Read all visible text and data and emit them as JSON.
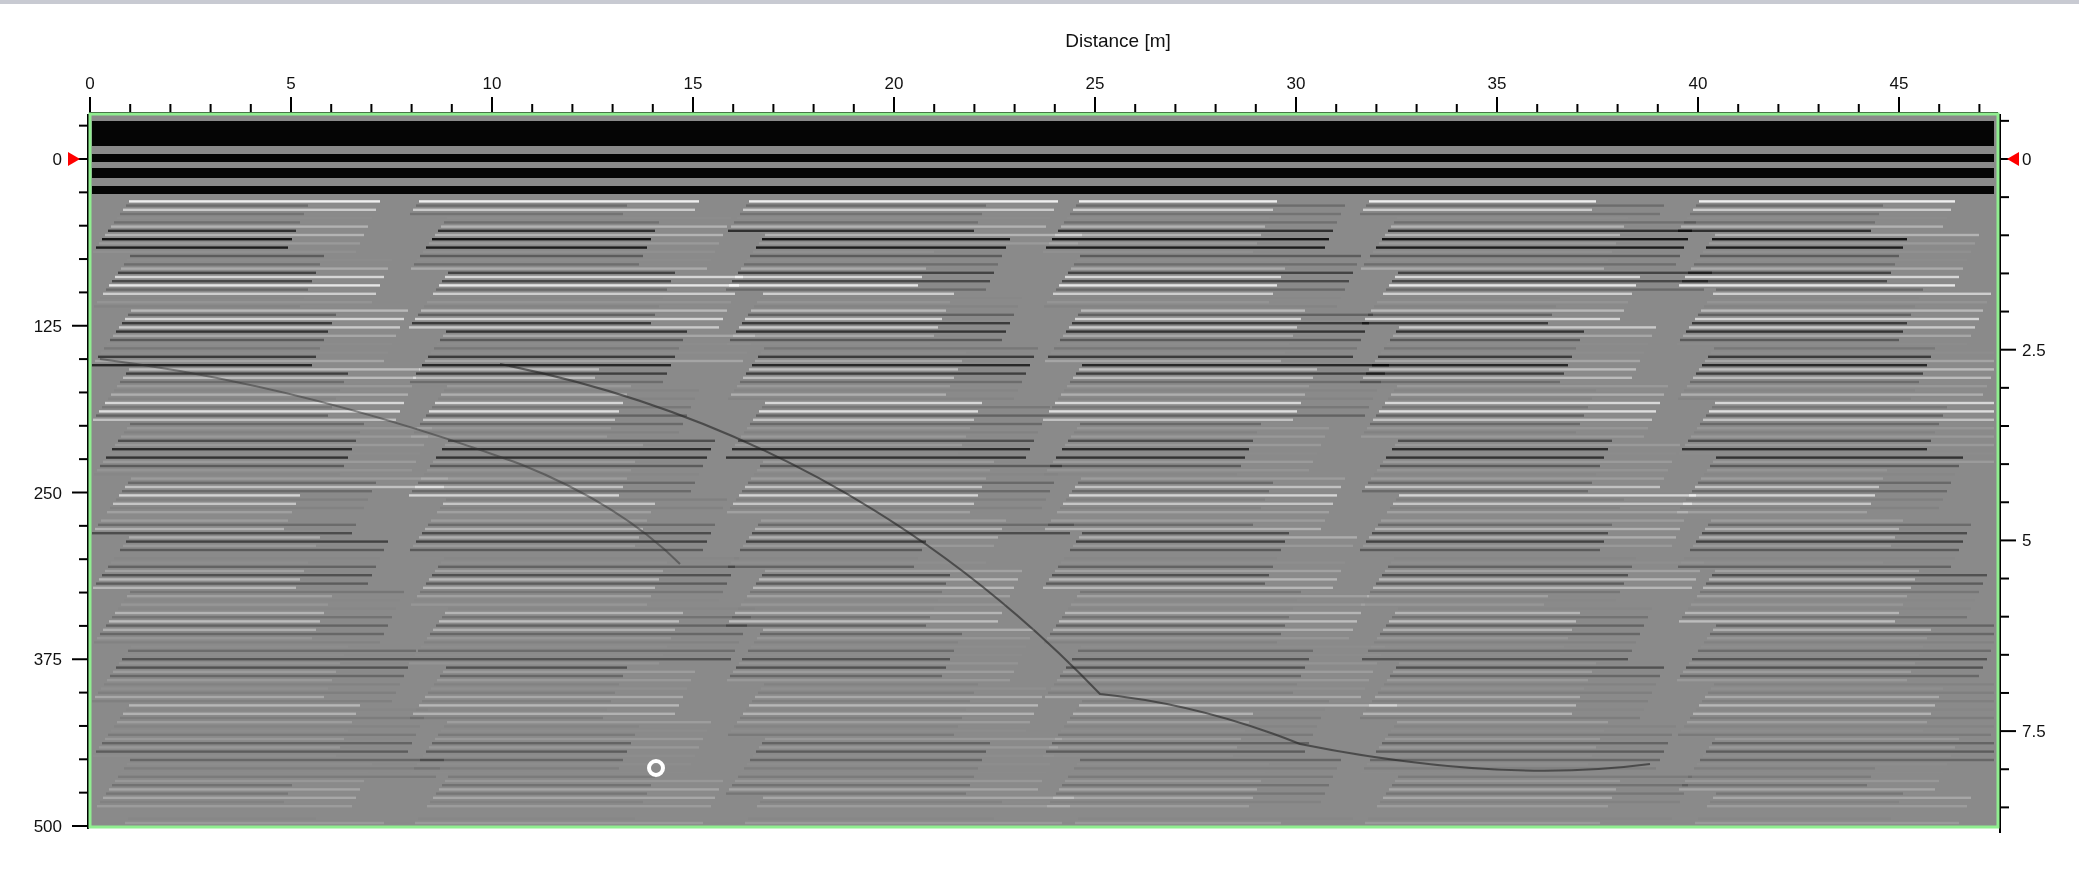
{
  "x_axis": {
    "title": "Distance [m]",
    "ticks": [
      "0",
      "5",
      "10",
      "15",
      "20",
      "25",
      "30",
      "35",
      "40",
      "45"
    ]
  },
  "left_axis": {
    "ticks": [
      "0",
      "125",
      "250",
      "375",
      "500"
    ]
  },
  "right_axis": {
    "ticks": [
      "0",
      "2.5",
      "5",
      "7.5"
    ]
  }
}
